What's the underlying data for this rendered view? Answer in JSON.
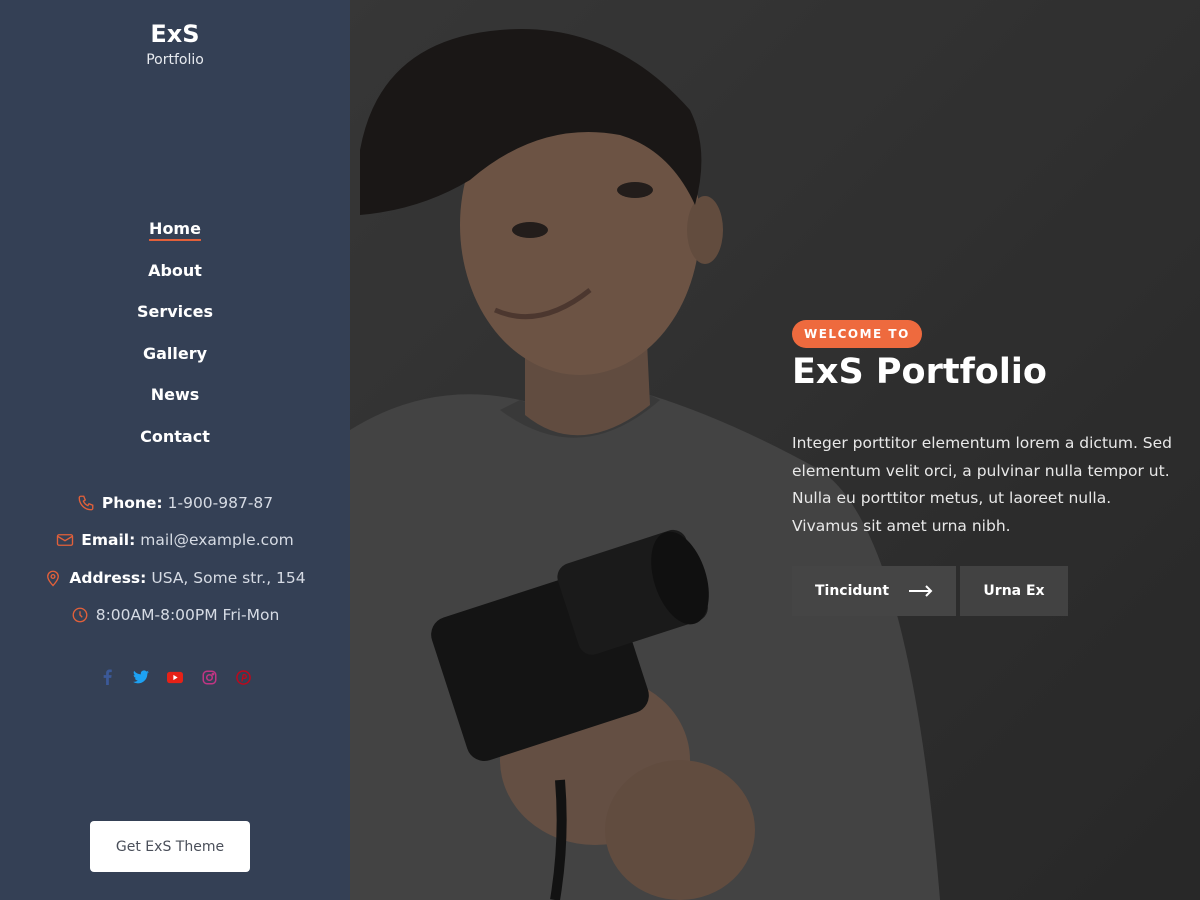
{
  "brand": {
    "title": "ExS",
    "subtitle": "Portfolio"
  },
  "nav": {
    "items": [
      {
        "label": "Home",
        "active": true
      },
      {
        "label": "About"
      },
      {
        "label": "Services"
      },
      {
        "label": "Gallery"
      },
      {
        "label": "News"
      },
      {
        "label": "Contact"
      }
    ]
  },
  "contacts": {
    "phone": {
      "label": "Phone:",
      "value": "1-900-987-87",
      "icon": "phone-icon"
    },
    "email": {
      "label": "Email:",
      "value": "mail@example.com",
      "icon": "mail-icon"
    },
    "address": {
      "label": "Address:",
      "value": "USA, Some str., 154",
      "icon": "location-pin-icon"
    },
    "hours": {
      "value": "8:00AM-8:00PM Fri-Mon",
      "icon": "clock-icon"
    }
  },
  "socials": [
    {
      "name": "facebook-icon",
      "color": "#3b5998"
    },
    {
      "name": "twitter-icon",
      "color": "#1da1f2"
    },
    {
      "name": "youtube-icon",
      "color": "#e62117"
    },
    {
      "name": "instagram-icon",
      "color": "#c13584"
    },
    {
      "name": "pinterest-icon",
      "color": "#bd081c"
    }
  ],
  "sidebar_button": {
    "label": "Get ExS Theme"
  },
  "hero": {
    "badge": "WELCOME TO",
    "title": "ExS Portfolio",
    "text": "Integer porttitor elementum lorem a dictum. Sed elementum velit orci, a pulvinar nulla tempor ut. Nulla eu porttitor metus, ut laoreet nulla. Vivamus sit amet urna nibh.",
    "primary_button": "Tincidunt",
    "secondary_button": "Urna Ex"
  },
  "colors": {
    "accent": "#ee6a3e",
    "sidebar": "#344055"
  }
}
